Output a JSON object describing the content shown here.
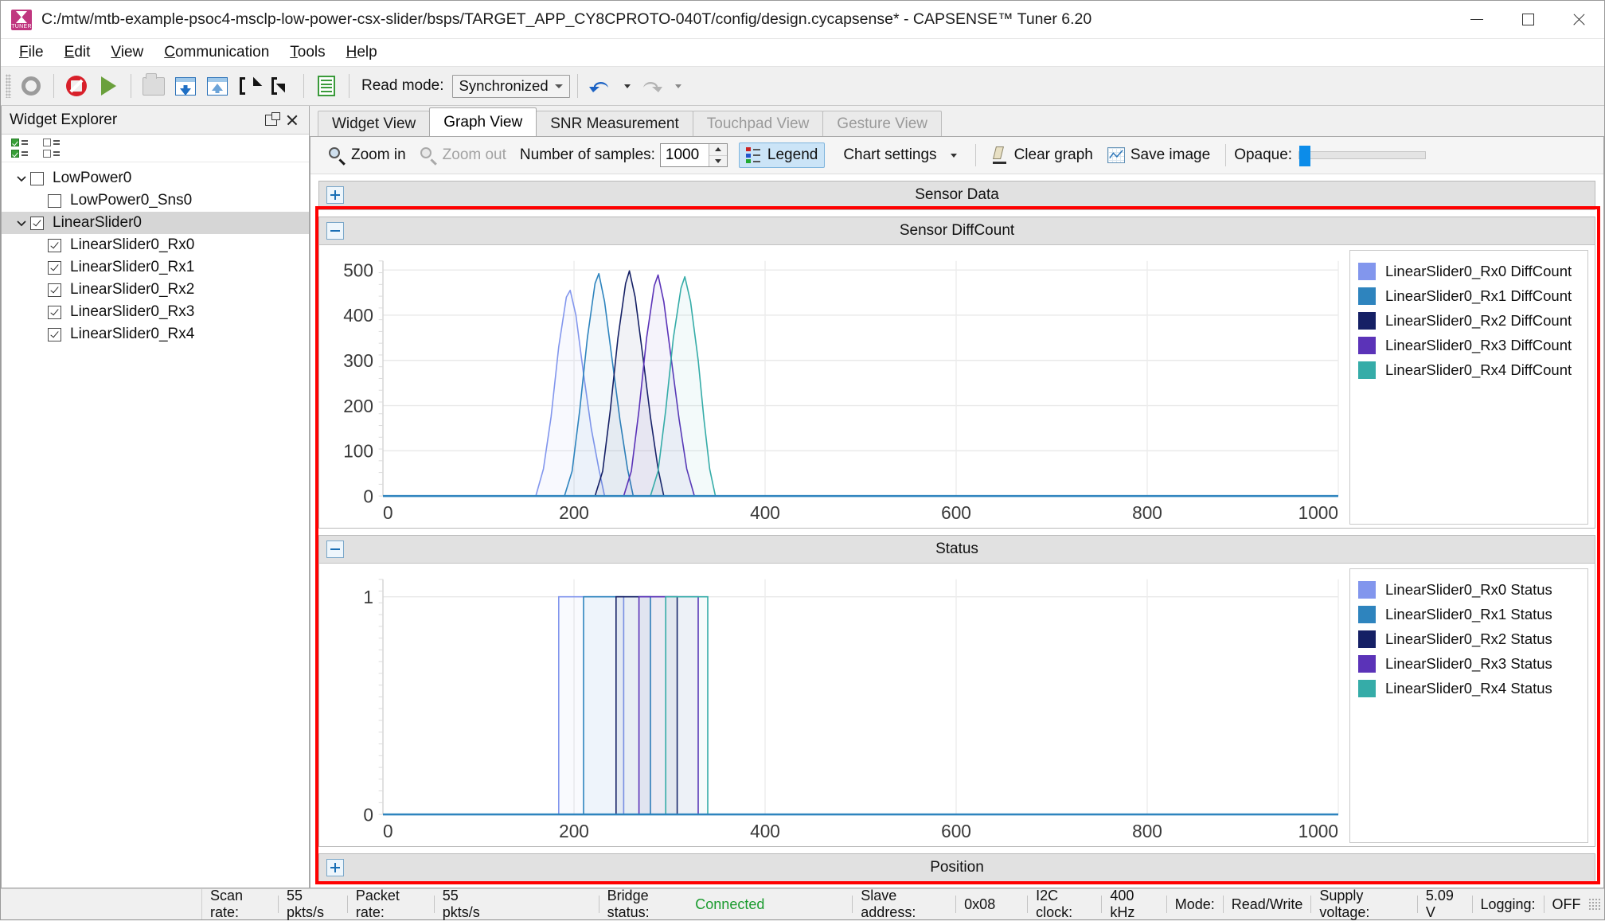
{
  "window": {
    "title": "C:/mtw/mtb-example-psoc4-msclp-low-power-csx-slider/bsps/TARGET_APP_CY8CPROTO-040T/config/design.cycapsense* - CAPSENSE™ Tuner 6.20",
    "minimize": "–",
    "maximize": "□",
    "close": "✕"
  },
  "menu": [
    "File",
    "Edit",
    "View",
    "Communication",
    "Tools",
    "Help"
  ],
  "toolbar": {
    "read_mode_label": "Read mode:",
    "read_mode_value": "Synchronized"
  },
  "explorer": {
    "title": "Widget Explorer",
    "items": [
      {
        "label": "LowPower0",
        "checked": false,
        "level": 0,
        "expandable": true,
        "selected": false
      },
      {
        "label": "LowPower0_Sns0",
        "checked": false,
        "level": 1,
        "expandable": false,
        "selected": false
      },
      {
        "label": "LinearSlider0",
        "checked": true,
        "level": 0,
        "expandable": true,
        "selected": true
      },
      {
        "label": "LinearSlider0_Rx0",
        "checked": true,
        "level": 1,
        "expandable": false,
        "selected": false
      },
      {
        "label": "LinearSlider0_Rx1",
        "checked": true,
        "level": 1,
        "expandable": false,
        "selected": false
      },
      {
        "label": "LinearSlider0_Rx2",
        "checked": true,
        "level": 1,
        "expandable": false,
        "selected": false
      },
      {
        "label": "LinearSlider0_Rx3",
        "checked": true,
        "level": 1,
        "expandable": false,
        "selected": false
      },
      {
        "label": "LinearSlider0_Rx4",
        "checked": true,
        "level": 1,
        "expandable": false,
        "selected": false
      }
    ]
  },
  "tabs": [
    {
      "label": "Widget View",
      "active": false,
      "disabled": false
    },
    {
      "label": "Graph View",
      "active": true,
      "disabled": false
    },
    {
      "label": "SNR Measurement",
      "active": false,
      "disabled": false
    },
    {
      "label": "Touchpad View",
      "active": false,
      "disabled": true
    },
    {
      "label": "Gesture View",
      "active": false,
      "disabled": true
    }
  ],
  "graph_toolbar": {
    "zoom_in": "Zoom in",
    "zoom_out": "Zoom out",
    "samples_label": "Number of samples:",
    "samples_value": "1000",
    "legend": "Legend",
    "chart_settings": "Chart settings",
    "clear_graph": "Clear graph",
    "save_image": "Save image",
    "opaque_label": "Opaque:"
  },
  "sections": [
    {
      "title": "Sensor Data",
      "collapsed": true
    },
    {
      "title": "Sensor DiffCount",
      "collapsed": false
    },
    {
      "title": "Status",
      "collapsed": false
    },
    {
      "title": "Position",
      "collapsed": true
    }
  ],
  "colors": {
    "rx0": "#8296ed",
    "rx1": "#2e84be",
    "rx2": "#152065",
    "rx3": "#5b33b8",
    "rx4": "#35aca8",
    "accent": "#0c8ce9",
    "highlight_box": "#ff0000",
    "connected": "#1a9b2e"
  },
  "statusbar": {
    "scan_rate_label": "Scan rate:",
    "scan_rate_value": "55 pkts/s",
    "packet_rate_label": "Packet rate:",
    "packet_rate_value": "55 pkts/s",
    "bridge_label": "Bridge status:",
    "bridge_value": "Connected",
    "slave_label": "Slave address:",
    "slave_value": "0x08",
    "i2c_label": "I2C clock:",
    "i2c_value": "400 kHz",
    "mode_label": "Mode:",
    "mode_value": "Read/Write",
    "supply_label": "Supply voltage:",
    "supply_value": "5.09 V",
    "logging_label": "Logging:",
    "logging_value": "OFF"
  },
  "chart_data": [
    {
      "id": "sensor_diffcount",
      "type": "line",
      "title": "Sensor DiffCount",
      "xlabel": "",
      "ylabel": "",
      "xlim": [
        0,
        1000
      ],
      "ylim": [
        0,
        520
      ],
      "xticks": [
        0,
        200,
        400,
        600,
        800,
        1000
      ],
      "yticks": [
        0,
        100,
        200,
        300,
        400,
        500
      ],
      "grid": true,
      "legend_position": "right",
      "series": [
        {
          "name": "LinearSlider0_Rx0 DiffCount",
          "color": "#8296ed",
          "peak_x": 196,
          "peak_y": 455,
          "x": [
            0,
            160,
            168,
            176,
            184,
            192,
            196,
            202,
            210,
            218,
            226,
            232,
            1000
          ],
          "y": [
            0,
            0,
            60,
            175,
            330,
            440,
            455,
            400,
            270,
            150,
            60,
            0,
            0
          ]
        },
        {
          "name": "LinearSlider0_Rx1 DiffCount",
          "color": "#2e84be",
          "peak_x": 226,
          "peak_y": 492,
          "x": [
            0,
            190,
            198,
            206,
            214,
            222,
            226,
            232,
            240,
            248,
            256,
            262,
            1000
          ],
          "y": [
            0,
            0,
            55,
            190,
            350,
            470,
            492,
            430,
            300,
            170,
            60,
            0,
            0
          ]
        },
        {
          "name": "LinearSlider0_Rx2 DiffCount",
          "color": "#152065",
          "peak_x": 258,
          "peak_y": 498,
          "x": [
            0,
            222,
            230,
            238,
            246,
            254,
            258,
            264,
            272,
            280,
            288,
            294,
            1000
          ],
          "y": [
            0,
            0,
            55,
            190,
            350,
            470,
            498,
            440,
            310,
            175,
            60,
            0,
            0
          ]
        },
        {
          "name": "LinearSlider0_Rx3 DiffCount",
          "color": "#5b33b8",
          "peak_x": 288,
          "peak_y": 489,
          "x": [
            0,
            252,
            260,
            268,
            276,
            284,
            288,
            294,
            302,
            310,
            318,
            326,
            1000
          ],
          "y": [
            0,
            0,
            55,
            190,
            350,
            465,
            489,
            430,
            300,
            170,
            60,
            0,
            0
          ]
        },
        {
          "name": "LinearSlider0_Rx4 DiffCount",
          "color": "#35aca8",
          "peak_x": 316,
          "peak_y": 485,
          "x": [
            0,
            280,
            288,
            296,
            304,
            312,
            316,
            322,
            330,
            336,
            342,
            348,
            1000
          ],
          "y": [
            0,
            0,
            55,
            190,
            350,
            460,
            485,
            430,
            300,
            170,
            60,
            0,
            0
          ]
        }
      ]
    },
    {
      "id": "status",
      "type": "line",
      "title": "Status",
      "xlabel": "",
      "ylabel": "",
      "xlim": [
        0,
        1000
      ],
      "ylim": [
        0,
        1.08
      ],
      "xticks": [
        0,
        200,
        400,
        600,
        800,
        1000
      ],
      "yticks": [
        0,
        1
      ],
      "grid": true,
      "legend_position": "right",
      "series": [
        {
          "name": "LinearSlider0_Rx0 Status",
          "color": "#8296ed",
          "on_from": 184,
          "on_to": 252
        },
        {
          "name": "LinearSlider0_Rx1 Status",
          "color": "#2e84be",
          "on_from": 210,
          "on_to": 280
        },
        {
          "name": "LinearSlider0_Rx2 Status",
          "color": "#152065",
          "on_from": 244,
          "on_to": 308
        },
        {
          "name": "LinearSlider0_Rx3 Status",
          "color": "#5b33b8",
          "on_from": 268,
          "on_to": 330
        },
        {
          "name": "LinearSlider0_Rx4 Status",
          "color": "#35aca8",
          "on_from": 296,
          "on_to": 340
        }
      ]
    }
  ]
}
